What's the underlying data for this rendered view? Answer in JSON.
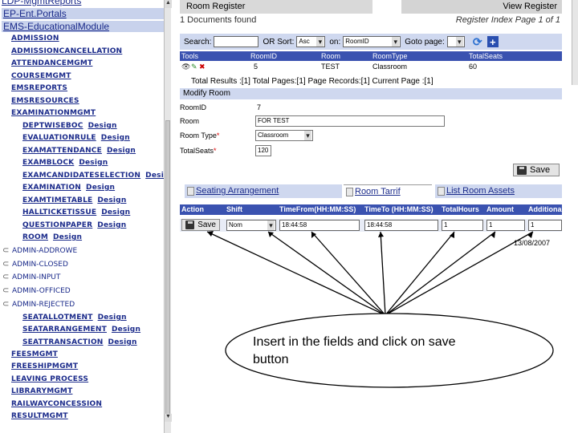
{
  "sidebar": {
    "top_links": [
      "LDP-MgmtReports",
      "EP-Ent.Portals",
      "EMS-EducationalModule"
    ],
    "items": [
      {
        "label": "ADMISSION",
        "design": ""
      },
      {
        "label": "ADMISSIONCANCELLATION",
        "design": ""
      },
      {
        "label": "ATTENDANCEMGMT",
        "design": ""
      },
      {
        "label": "COURSEMGMT",
        "design": ""
      },
      {
        "label": "EMSREPORTS",
        "design": ""
      },
      {
        "label": "EMSRESOURCES",
        "design": ""
      },
      {
        "label": "EXAMINATIONMGMT",
        "design": ""
      }
    ],
    "exam_subitems": [
      {
        "label": "DEPTWISEBOC",
        "design": "Design"
      },
      {
        "label": "EVALUATIONRULE",
        "design": "Design"
      },
      {
        "label": "EXAMATTENDANCE",
        "design": "Design"
      },
      {
        "label": "EXAMBLOCK",
        "design": "Design"
      },
      {
        "label": "EXAMCANDIDATESELECTION",
        "design": "Desig"
      },
      {
        "label": "EXAMINATION",
        "design": "Design"
      },
      {
        "label": "EXAMTIMETABLE",
        "design": "Design"
      },
      {
        "label": "HALLTICKETISSUE",
        "design": "Design"
      },
      {
        "label": "QUESTIONPAPER",
        "design": "Design"
      },
      {
        "label": "ROOM",
        "design": "Design"
      }
    ],
    "admin_items": [
      "ADMIN-ADDROWE",
      "ADMIN-CLOSED",
      "ADMIN-INPUT",
      "ADMIN-OFFICED",
      "ADMIN-REJECTED"
    ],
    "seat_items": [
      {
        "label": "SEATALLOTMENT",
        "design": "Design"
      },
      {
        "label": "SEATARRANGEMENT",
        "design": "Design"
      },
      {
        "label": "SEATTRANSACTION",
        "design": "Design"
      }
    ],
    "bottom_items": [
      "FEESMGMT",
      "FREESHIPMGMT",
      "LEAVING PROCESS",
      "LIBRARYMGMT",
      "RAILWAYCONCESSION",
      "RESULTMGMT"
    ]
  },
  "header": {
    "left_title": "Room Register",
    "right_title": "View Register",
    "docs_found": "1 Documents found",
    "register_index": "Register Index Page 1 of 1"
  },
  "search": {
    "search_label": "Search:",
    "search_value": "",
    "or_sort_label": "OR Sort:",
    "sort_value": "Asc",
    "on_label": "on:",
    "on_value": "RoomID",
    "goto_label": "Goto page:",
    "goto_value": ""
  },
  "grid": {
    "headers": [
      "Tools",
      "RoomID",
      "Room",
      "RoomType",
      "TotalSeats"
    ],
    "row": [
      "",
      "5",
      "TEST",
      "Classroom",
      "60"
    ],
    "summary": "Total Results :[1]   Total Pages:[1]   Page Records:[1]   Current Page :[1]"
  },
  "modify": {
    "section_title": "Modify Room",
    "fields": [
      {
        "label": "RoomID",
        "required": "",
        "value": "7",
        "kind": "text"
      },
      {
        "label": "Room",
        "required": "",
        "value": "FOR TEST",
        "kind": "input"
      },
      {
        "label": "Room Type",
        "required": "*",
        "value": "Classroom",
        "kind": "select"
      },
      {
        "label": "TotalSeats",
        "required": "*",
        "value": "120",
        "kind": "input"
      }
    ],
    "save_label": "Save"
  },
  "tabs": [
    {
      "label": "Seating Arrangement"
    },
    {
      "label": "Room Tarrif"
    },
    {
      "label": "List Room Assets"
    }
  ],
  "action_table": {
    "headers": [
      "Action",
      "Shift",
      "TimeFrom(HH:MM:SS)",
      "TimeTo (HH:MM:SS)",
      "TotalHours",
      "Amount",
      "AdditionalPer"
    ],
    "save_label": "Save",
    "shift_value": "Nom",
    "time_from": "18:44:58",
    "time_to": "18:44:58",
    "total_hours": "1",
    "amount": "1",
    "additional": "1"
  },
  "date_text": "13/08/2007",
  "callout": {
    "line1": "Insert in the fields and click on save",
    "line2": "button"
  }
}
